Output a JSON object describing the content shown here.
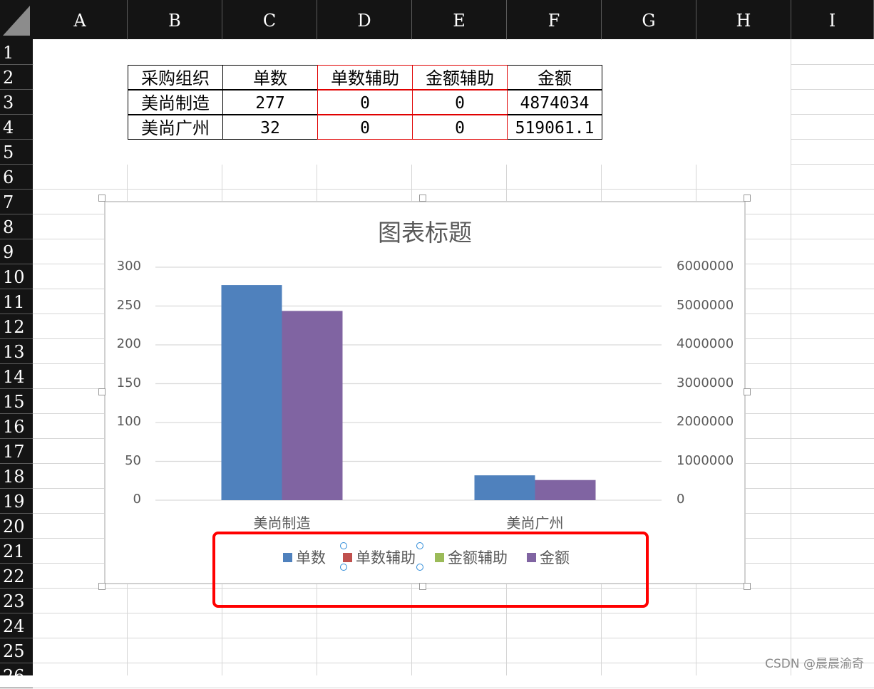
{
  "columns": [
    "A",
    "B",
    "C",
    "D",
    "E",
    "F",
    "G",
    "H",
    "I"
  ],
  "rows": [
    "1",
    "2",
    "3",
    "4",
    "5",
    "6",
    "7",
    "8",
    "9",
    "10",
    "11",
    "12",
    "13",
    "14",
    "15",
    "16",
    "17",
    "18",
    "19",
    "20",
    "21",
    "22",
    "23",
    "24",
    "25",
    "26"
  ],
  "table": {
    "headers": [
      "采购组织",
      "单数",
      "单数辅助",
      "金额辅助",
      "金额"
    ],
    "rows": [
      [
        "美尚制造",
        "277",
        "0",
        "0",
        "4874034"
      ],
      [
        "美尚广州",
        "32",
        "0",
        "0",
        "519061.1"
      ]
    ]
  },
  "chart_data": {
    "type": "bar",
    "title": "图表标题",
    "categories": [
      "美尚制造",
      "美尚广州"
    ],
    "series": [
      {
        "name": "单数",
        "axis": "left",
        "values": [
          277,
          32
        ],
        "color": "#4f81bd"
      },
      {
        "name": "单数辅助",
        "axis": "left",
        "values": [
          0,
          0
        ],
        "color": "#c0504d"
      },
      {
        "name": "金额辅助",
        "axis": "right",
        "values": [
          0,
          0
        ],
        "color": "#9bbb59"
      },
      {
        "name": "金额",
        "axis": "right",
        "values": [
          4874034,
          519061.1
        ],
        "color": "#8064a2"
      }
    ],
    "ylim_left": [
      0,
      300
    ],
    "ylim_right": [
      0,
      6000000
    ],
    "yticks_left": [
      "300",
      "250",
      "200",
      "150",
      "100",
      "50",
      "0"
    ],
    "yticks_right": [
      "6000000",
      "5000000",
      "4000000",
      "3000000",
      "2000000",
      "1000000",
      "0"
    ],
    "grid": true,
    "legend_position": "bottom"
  },
  "colors": {
    "header_bg": "#141414",
    "grid": "#d6d6d6",
    "highlight": "#ff0000",
    "selection": "#2e8bd8"
  },
  "watermark": "CSDN @晨晨渝奇"
}
